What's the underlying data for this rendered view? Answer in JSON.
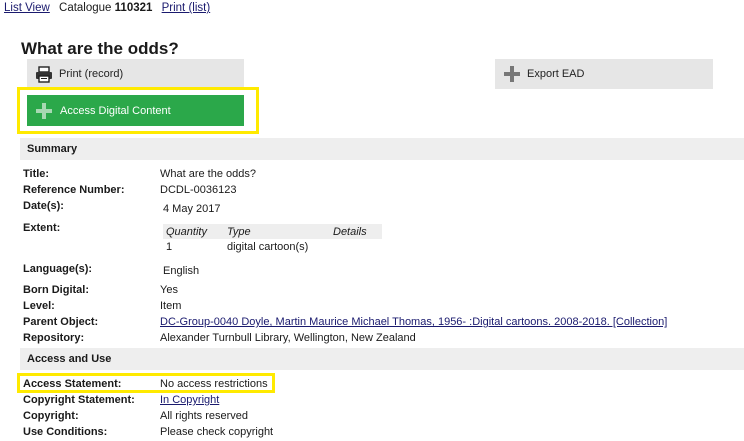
{
  "topnav": {
    "list_view": "List View",
    "catalogue_label": "Catalogue",
    "catalogue_number": "110321",
    "print_list": "Print (list)"
  },
  "page_title": "What are the odds?",
  "buttons": {
    "print_record": "Print (record)",
    "export_ead": "Export EAD",
    "access_digital": "Access Digital Content"
  },
  "summary": {
    "heading": "Summary",
    "title_label": "Title:",
    "title_value": "What are the odds?",
    "reference_label": "Reference Number:",
    "reference_value": "DCDL-0036123",
    "dates_label": "Date(s):",
    "dates_value": "4 May 2017",
    "extent_label": "Extent:",
    "extent_headers": [
      "Quantity",
      "Type",
      "Details"
    ],
    "extent_rows": [
      [
        "1",
        "digital cartoon(s)",
        ""
      ]
    ],
    "language_label": "Language(s):",
    "language_value": "English",
    "born_digital_label": "Born Digital:",
    "born_digital_value": "Yes",
    "level_label": "Level:",
    "level_value": "Item",
    "parent_label": "Parent Object:",
    "parent_value": "DC-Group-0040  Doyle, Martin Maurice Michael Thomas, 1956- :Digital cartoons. 2008-2018. [Collection]",
    "repository_label": "Repository:",
    "repository_value": "Alexander Turnbull Library, Wellington, New Zealand"
  },
  "access": {
    "heading": "Access and Use",
    "statement_label": "Access Statement:",
    "statement_value": "No access restrictions",
    "copyright_statement_label": "Copyright Statement:",
    "copyright_statement_value": "In Copyright",
    "copyright_label": "Copyright:",
    "copyright_value": "All rights reserved",
    "use_label": "Use Conditions:",
    "use_value": "Please check copyright"
  },
  "colors": {
    "green_button": "#2ba84a",
    "highlight": "#ffea00",
    "link": "#1a1a6e",
    "section_bg": "#eeeeee"
  }
}
